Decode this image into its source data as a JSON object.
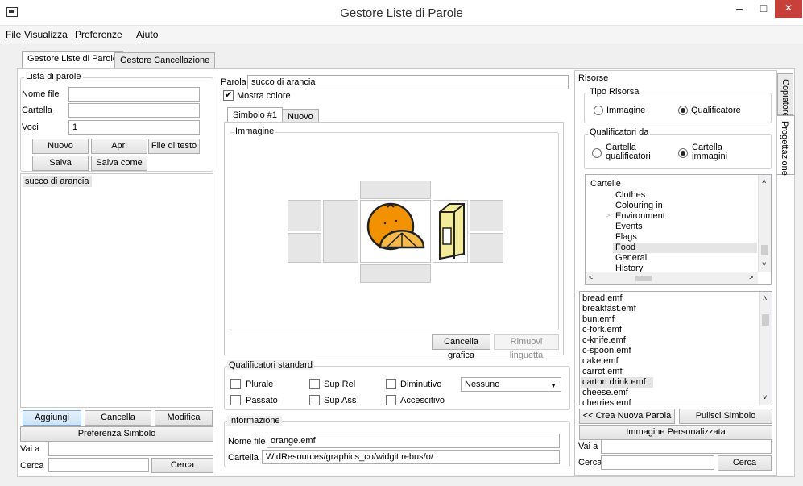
{
  "window": {
    "title": "Gestore Liste di Parole",
    "minimize": "–",
    "maximize": "□",
    "close": "✕"
  },
  "menu": [
    {
      "label_first": "F",
      "label_rest": "ile"
    },
    {
      "label_first": "V",
      "label_rest": "isualizza"
    },
    {
      "label_first": "P",
      "label_rest": "referenze"
    },
    {
      "label_first": "A",
      "label_rest": "iuto"
    }
  ],
  "tabs": {
    "tab1": "Gestore Liste di Parole",
    "tab2": "Gestore Cancellazione"
  },
  "left": {
    "group_title": "Lista di parole",
    "nome_file_label": "Nome file",
    "nome_file_value": "",
    "cartella_label": "Cartella",
    "cartella_value": "",
    "voci_label": "Voci",
    "voci_value": "1",
    "btn_nuovo": "Nuovo",
    "btn_apri": "Apri",
    "btn_file_testo": "File di testo",
    "btn_salva": "Salva",
    "btn_salva_come": "Salva come",
    "list_items": [
      "succo di arancia"
    ],
    "btn_aggiungi": "Aggiungi",
    "btn_cancella": "Cancella",
    "btn_modifica": "Modifica",
    "btn_preferenza": "Preferenza Simbolo",
    "vai_a_label": "Vai a",
    "vai_a_value": "",
    "cerca_label": "Cerca",
    "cerca_value": "",
    "btn_cerca": "Cerca"
  },
  "center": {
    "parola_label": "Parola",
    "parola_value": "succo di arancia",
    "mostra_colore": "Mostra colore",
    "mostra_colore_checked": true,
    "symbol_tab1": "Simbolo #1",
    "symbol_tab2": "Nuovo",
    "immagine_label": "Immagine",
    "btn_cancella_grafica": "Cancella grafica",
    "btn_rimuovi_linguetta": "Rimuovi linguetta",
    "qualificatori_title": "Qualificatori standard",
    "qual": {
      "plurale": "Plurale",
      "sup_rel": "Sup Rel",
      "diminutivo": "Diminutivo",
      "passato": "Passato",
      "sup_ass": "Sup Ass",
      "accrescitivo": "Accescitivo"
    },
    "qual_select": "Nessuno",
    "info_title": "Informazione",
    "info_nome_file_label": "Nome file",
    "info_nome_file_value": "orange.emf",
    "info_cartella_label": "Cartella",
    "info_cartella_value": "WidResources/graphics_co/widgit rebus/o/"
  },
  "right": {
    "risorse_title": "Risorse",
    "tipo_risorsa_title": "Tipo Risorsa",
    "radio_immagine": "Immagine",
    "radio_qualificatore": "Qualificatore",
    "qual_da_title": "Qualificatori da",
    "radio_cartella_qual_1": "Cartella",
    "radio_cartella_qual_2": "qualificatori",
    "radio_cartella_imm_1": "Cartella",
    "radio_cartella_imm_2": "immagini",
    "tree_header": "Cartelle",
    "tree": [
      "Clothes",
      "Colouring in",
      "Environment",
      "Events",
      "Flags",
      "Food",
      "General",
      "History"
    ],
    "tree_selected": "Food",
    "files": [
      "bread.emf",
      "breakfast.emf",
      "bun.emf",
      "c-fork.emf",
      "c-knife.emf",
      "c-spoon.emf",
      "cake.emf",
      "carrot.emf",
      "carton drink.emf",
      "cheese.emf",
      "cherries.emf"
    ],
    "file_selected": "carton drink.emf",
    "btn_crea": "<< Crea Nuova Parola",
    "btn_pulisci": "Pulisci Simbolo",
    "btn_immagine_pers": "Immagine Personalizzata",
    "vai_a_label": "Vai a",
    "cerca_label": "Cerca",
    "btn_cerca": "Cerca",
    "side_tab1": "Copiatore",
    "side_tab2": "Progettazione"
  },
  "colors": {
    "orange": "#f39200",
    "accent_blue": "#cce4f7",
    "close_red": "#c7403a"
  }
}
